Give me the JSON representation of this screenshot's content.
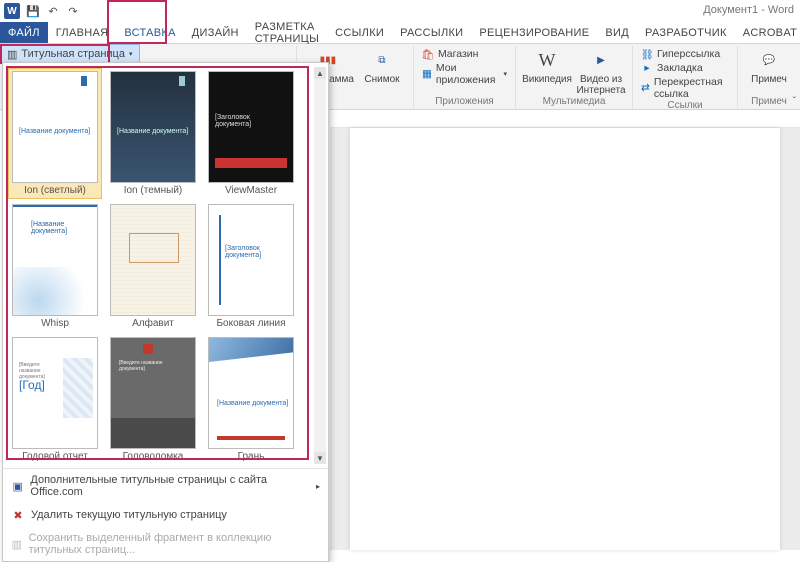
{
  "title": "Документ1 - Word",
  "qat": {
    "save": "💾",
    "undo": "↶",
    "redo": "↷"
  },
  "tabs": {
    "file": "ФАЙЛ",
    "items": [
      "ГЛАВНАЯ",
      "ВСТАВКА",
      "ДИЗАЙН",
      "РАЗМЕТКА СТРАНИЦЫ",
      "ССЫЛКИ",
      "РАССЫЛКИ",
      "РЕЦЕНЗИРОВАНИЕ",
      "ВИД",
      "РАЗРАБОТЧИК",
      "ACROBAT"
    ],
    "active_index": 1
  },
  "cover_btn": {
    "label": "Титульная страница",
    "icon": "▫"
  },
  "ribbon": {
    "groups": {
      "illustrations": {
        "diagram": "Диаграмма",
        "screenshot": "Снимок"
      },
      "apps": {
        "store": "Магазин",
        "myapps": "Мои приложения",
        "grouplabel": "Приложения"
      },
      "media": {
        "wikipedia": "Википедия",
        "video": "Видео из Интернета",
        "grouplabel": "Мультимедиа"
      },
      "links": {
        "hyperlink": "Гиперссылка",
        "bookmark": "Закладка",
        "crossref": "Перекрестная ссылка",
        "grouplabel": "Ссылки"
      },
      "comments": {
        "comment": "Примеч",
        "grouplabel": "Примеч"
      }
    }
  },
  "gallery": {
    "items": [
      {
        "label": "Ion (светлый)"
      },
      {
        "label": "Ion (темный)"
      },
      {
        "label": "ViewMaster"
      },
      {
        "label": "Whisp"
      },
      {
        "label": "Алфавит"
      },
      {
        "label": "Боковая линия"
      },
      {
        "label": "Годовой отчет"
      },
      {
        "label": "Головоломка"
      },
      {
        "label": "Грань"
      }
    ],
    "footer": {
      "more": "Дополнительные титульные страницы с сайта Office.com",
      "remove": "Удалить текущую титульную страницу",
      "save": "Сохранить выделенный фрагмент в коллекцию титульных страниц..."
    },
    "thumb_text": {
      "ion_light": "[Название документа]",
      "ion_dark": "[Название документа]",
      "viewmaster": "[Заголовок документа]",
      "whisp": "[Название документа]",
      "bokovaya": "[Заголовок документа]",
      "godovoy_title": "[Введите название документа]",
      "godovoy_year": "[Год]",
      "golovo": "[Введите название документа]",
      "gran": "[Название документа]"
    }
  }
}
